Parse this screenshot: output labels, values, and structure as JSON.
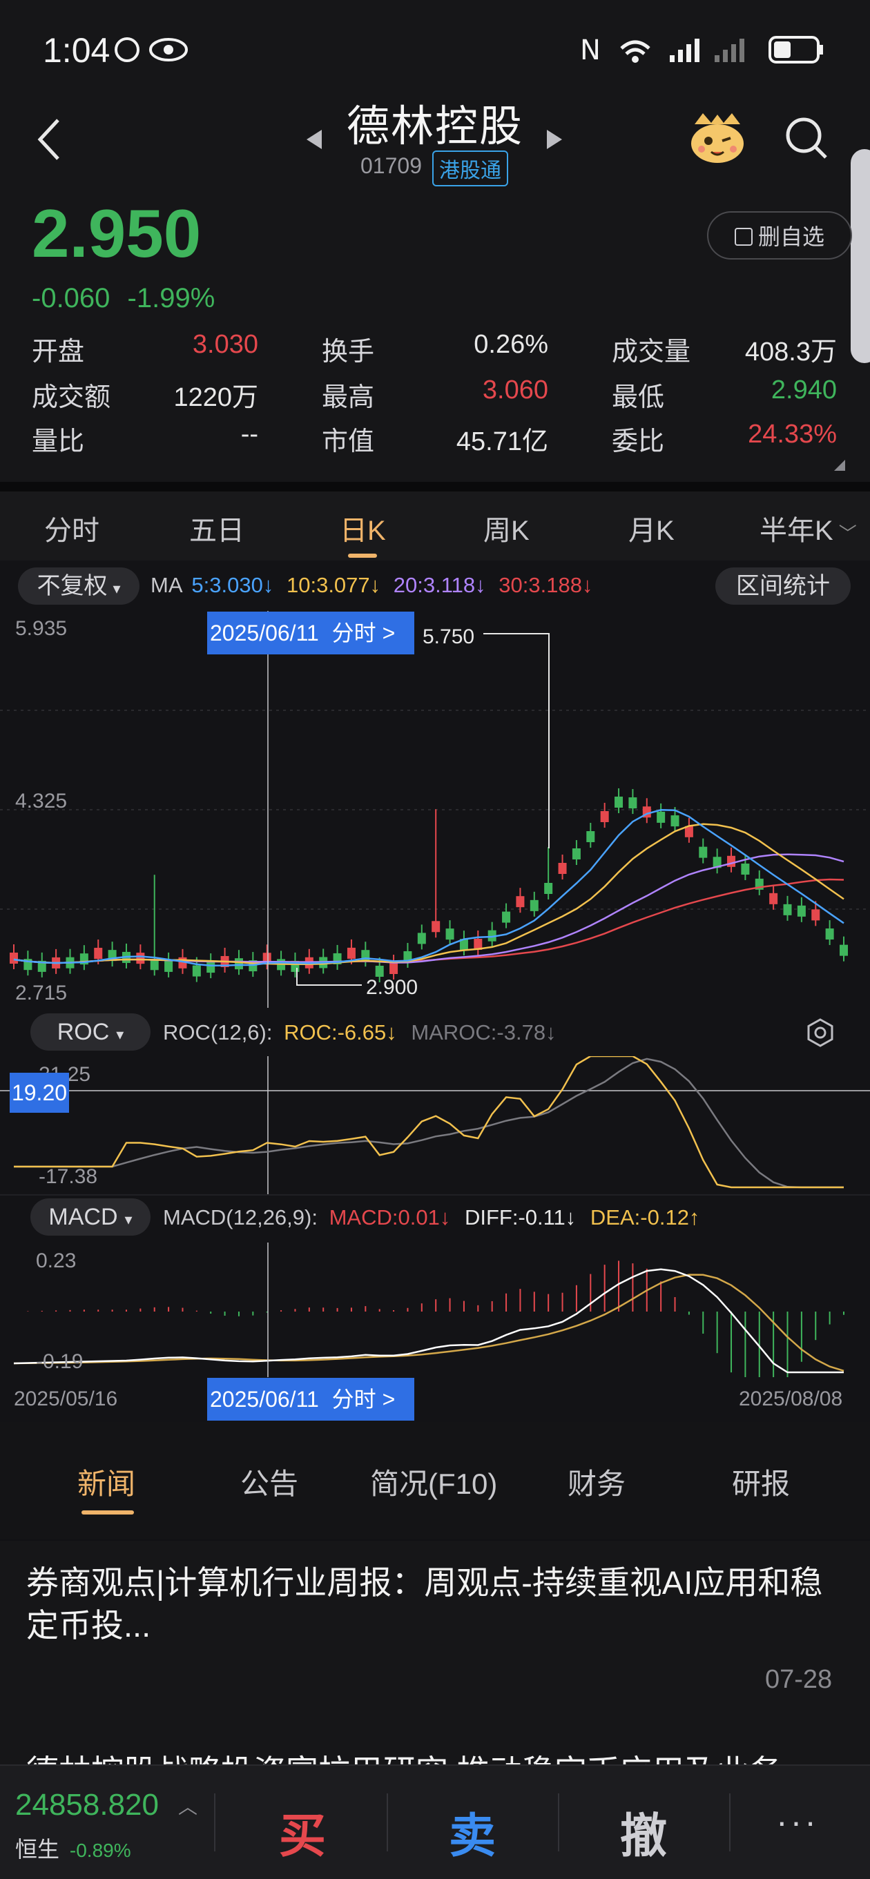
{
  "status_bar": {
    "time": "1:04"
  },
  "header": {
    "title": "德林控股",
    "code": "01709",
    "badge": "港股通"
  },
  "quote": {
    "price": "2.950",
    "change": "-0.060",
    "change_pct": "-1.99%",
    "delete_watch": "删自选",
    "rows": [
      [
        {
          "label": "开盘",
          "value": "3.030",
          "color": "red"
        },
        {
          "label": "换手",
          "value": "0.26%",
          "color": "white"
        },
        {
          "label": "成交量",
          "value": "408.3万",
          "color": "white"
        }
      ],
      [
        {
          "label": "成交额",
          "value": "1220万",
          "color": "white"
        },
        {
          "label": "最高",
          "value": "3.060",
          "color": "red"
        },
        {
          "label": "最低",
          "value": "2.940",
          "color": "green"
        }
      ],
      [
        {
          "label": "量比",
          "value": "--",
          "color": "white"
        },
        {
          "label": "市值",
          "value": "45.71亿",
          "color": "white"
        },
        {
          "label": "委比",
          "value": "24.33%",
          "color": "red"
        }
      ]
    ]
  },
  "period_tabs": [
    "分时",
    "五日",
    "日K",
    "周K",
    "月K",
    "半年K"
  ],
  "active_period": "日K",
  "kline": {
    "adjust": "不复权",
    "ma_label": "MA",
    "ma": [
      {
        "label": "5:3.030↓",
        "color": "#4aa3ff"
      },
      {
        "label": "10:3.077↓",
        "color": "#f2c14e"
      },
      {
        "label": "20:3.118↓",
        "color": "#b084ff"
      },
      {
        "label": "30:3.188↓",
        "color": "#e5484d"
      }
    ],
    "range_stats": "区间统计",
    "y_top": "5.935",
    "y_mid": "4.325",
    "y_bottom": "2.715",
    "max_label": "5.750",
    "min_label": "2.900",
    "cursor_date": "2025/06/11",
    "cursor_link": "分时 >"
  },
  "roc": {
    "selector": "ROC",
    "params": "ROC(12,6):",
    "roc_value": "ROC:-6.65↓",
    "maroc_value": "MAROC:-3.78↓",
    "cursor_value": "19.20",
    "y_top": "21.25",
    "y_bottom": "-17.38"
  },
  "macd": {
    "selector": "MACD",
    "params": "MACD(12,26,9):",
    "macd_value": "MACD:0.01↓",
    "diff_value": "DIFF:-0.11↓",
    "dea_value": "DEA:-0.12↑",
    "y_top": "0.23",
    "y_bottom": "-0.19"
  },
  "x_axis": {
    "start": "2025/05/16",
    "end": "2025/08/08"
  },
  "news_tabs": [
    "新闻",
    "公告",
    "简况(F10)",
    "财务",
    "研报"
  ],
  "active_news_tab": "新闻",
  "news": [
    {
      "title": "券商观点|计算机行业周报：周观点-持续重视AI应用和稳定币投...",
      "date": "07-28"
    },
    {
      "title": "德林控股战略投资富拉巴研究 推动稳定币应用及业务"
    }
  ],
  "index": {
    "value": "24858.820",
    "name": "恒生",
    "change": "-0.89%"
  },
  "actions": {
    "buy": "买",
    "sell": "卖",
    "cancel": "撤",
    "more": "···"
  }
}
